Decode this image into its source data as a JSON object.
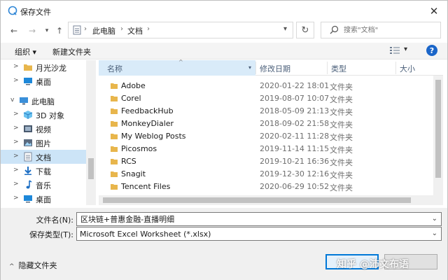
{
  "window": {
    "title": "保存文件"
  },
  "address": {
    "crumbs": [
      "此电脑",
      "文档"
    ]
  },
  "search": {
    "placeholder": "搜索\"文档\""
  },
  "toolbar": {
    "organize": "组织 ▾",
    "new_folder": "新建文件夹",
    "view_dropdown": "▾",
    "help": "?"
  },
  "nav_pane": {
    "items": [
      {
        "label": "月光沙龙",
        "icon": "folder-icon",
        "expander": ">"
      },
      {
        "label": "桌面",
        "icon": "desktop-icon",
        "expander": ">"
      },
      {
        "label": "此电脑",
        "icon": "computer-icon",
        "expander": "v"
      },
      {
        "label": "3D 对象",
        "icon": "cube-icon",
        "expander": ">"
      },
      {
        "label": "视频",
        "icon": "video-icon",
        "expander": ">"
      },
      {
        "label": "图片",
        "icon": "picture-icon",
        "expander": ">"
      },
      {
        "label": "文档",
        "icon": "document-icon",
        "expander": ">",
        "selected": true
      },
      {
        "label": "下载",
        "icon": "download-icon",
        "expander": ">"
      },
      {
        "label": "音乐",
        "icon": "music-icon",
        "expander": ">"
      },
      {
        "label": "桌面",
        "icon": "desktop-icon",
        "expander": ">"
      }
    ]
  },
  "file_list": {
    "columns": [
      "名称",
      "修改日期",
      "类型",
      "大小"
    ],
    "rows": [
      {
        "name": "Adobe",
        "modified": "2020-01-22 18:01",
        "type": "文件夹"
      },
      {
        "name": "Corel",
        "modified": "2019-08-07 10:07",
        "type": "文件夹"
      },
      {
        "name": "FeedbackHub",
        "modified": "2018-05-09 21:13",
        "type": "文件夹"
      },
      {
        "name": "MonkeyDialer",
        "modified": "2018-09-02 21:58",
        "type": "文件夹"
      },
      {
        "name": "My Weblog Posts",
        "modified": "2020-02-11 11:28",
        "type": "文件夹"
      },
      {
        "name": "Picosmos",
        "modified": "2019-11-14 11:15",
        "type": "文件夹"
      },
      {
        "name": "RCS",
        "modified": "2019-10-21 16:36",
        "type": "文件夹"
      },
      {
        "name": "Snagit",
        "modified": "2019-12-30 12:16",
        "type": "文件夹"
      },
      {
        "name": "Tencent Files",
        "modified": "2020-06-29 10:52",
        "type": "文件夹"
      }
    ]
  },
  "form": {
    "filename_label": "文件名(N):",
    "filename_value": "区块链+普惠金融-直播明细",
    "filetype_label": "保存类型(T):",
    "filetype_value": "Microsoft Excel Worksheet (*.xlsx)"
  },
  "footer": {
    "hide_folders": "隐藏文件夹",
    "watermark": "知乎 @沛文布语"
  },
  "colors": {
    "accent": "#0078d7",
    "selection": "#cce4f7",
    "folder": "#e8b64c",
    "help": "#1b66c9"
  }
}
